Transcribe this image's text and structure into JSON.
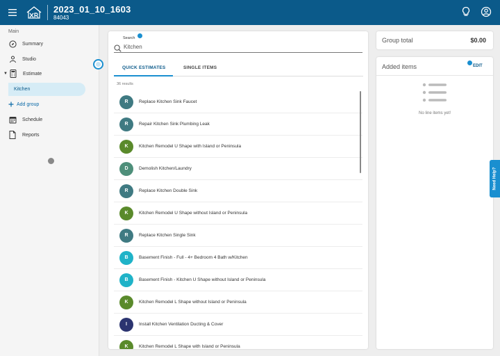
{
  "header": {
    "title": "2023_01_10_1603",
    "subtitle": "84043",
    "logo_text": "XR",
    "icons": [
      "menu-icon",
      "lightbulb-icon",
      "account-icon"
    ]
  },
  "sidebar": {
    "section_label": "Main",
    "items": [
      {
        "label": "Summary",
        "icon": "compass-icon"
      },
      {
        "label": "Studio",
        "icon": "person-icon"
      },
      {
        "label": "Estimate",
        "icon": "calculator-icon"
      },
      {
        "label": "Kitchen",
        "icon": ""
      },
      {
        "label": "Add group",
        "icon": "plus-icon"
      },
      {
        "label": "Schedule",
        "icon": "calendar-icon"
      },
      {
        "label": "Reports",
        "icon": "document-icon"
      }
    ]
  },
  "search": {
    "label": "Search",
    "value": "Kitchen",
    "placeholder": ""
  },
  "tabs": [
    {
      "label": "QUICK ESTIMATES",
      "active": true
    },
    {
      "label": "SINGLE ITEMS",
      "active": false
    }
  ],
  "results_count": "36 results",
  "items": [
    {
      "initial": "R",
      "color": "#3f7a82",
      "label": "Replace Kitchen Sink Faucet"
    },
    {
      "initial": "R",
      "color": "#3f7a82",
      "label": "Repair Kitchen Sink Plumbing Leak"
    },
    {
      "initial": "K",
      "color": "#5a8a2b",
      "label": "Kitchen Remodel U Shape with Island or Peninsula"
    },
    {
      "initial": "D",
      "color": "#4e8f7a",
      "label": "Demolish Kitchen/Laundry"
    },
    {
      "initial": "R",
      "color": "#3f7a82",
      "label": "Replace Kitchen Double Sink"
    },
    {
      "initial": "K",
      "color": "#5a8a2b",
      "label": "Kitchen Remodel U Shape without Island or Peninsula"
    },
    {
      "initial": "R",
      "color": "#3f7a82",
      "label": "Replace Kitchen Single Sink"
    },
    {
      "initial": "B",
      "color": "#1fb3c8",
      "label": "Basement Finish - Full - 4+ Bedroom 4 Bath w/Kitchen"
    },
    {
      "initial": "B",
      "color": "#1fb3c8",
      "label": "Basement Finish - Kitchen U Shape without Island or Peninsula"
    },
    {
      "initial": "K",
      "color": "#5a8a2b",
      "label": "Kitchen Remodel L Shape without Island or Peninsula"
    },
    {
      "initial": "I",
      "color": "#2b3470",
      "label": "Install Kitchen Ventilation Ducting & Cover"
    },
    {
      "initial": "K",
      "color": "#5a8a2b",
      "label": "Kitchen Remodel L Shape with Island or Peninsula"
    }
  ],
  "group_total": {
    "label": "Group total",
    "value": "$0.00"
  },
  "added_items": {
    "label": "Added items",
    "edit_label": "EDIT",
    "empty_text": "No line items yet!"
  },
  "need_help": "Need Help?"
}
